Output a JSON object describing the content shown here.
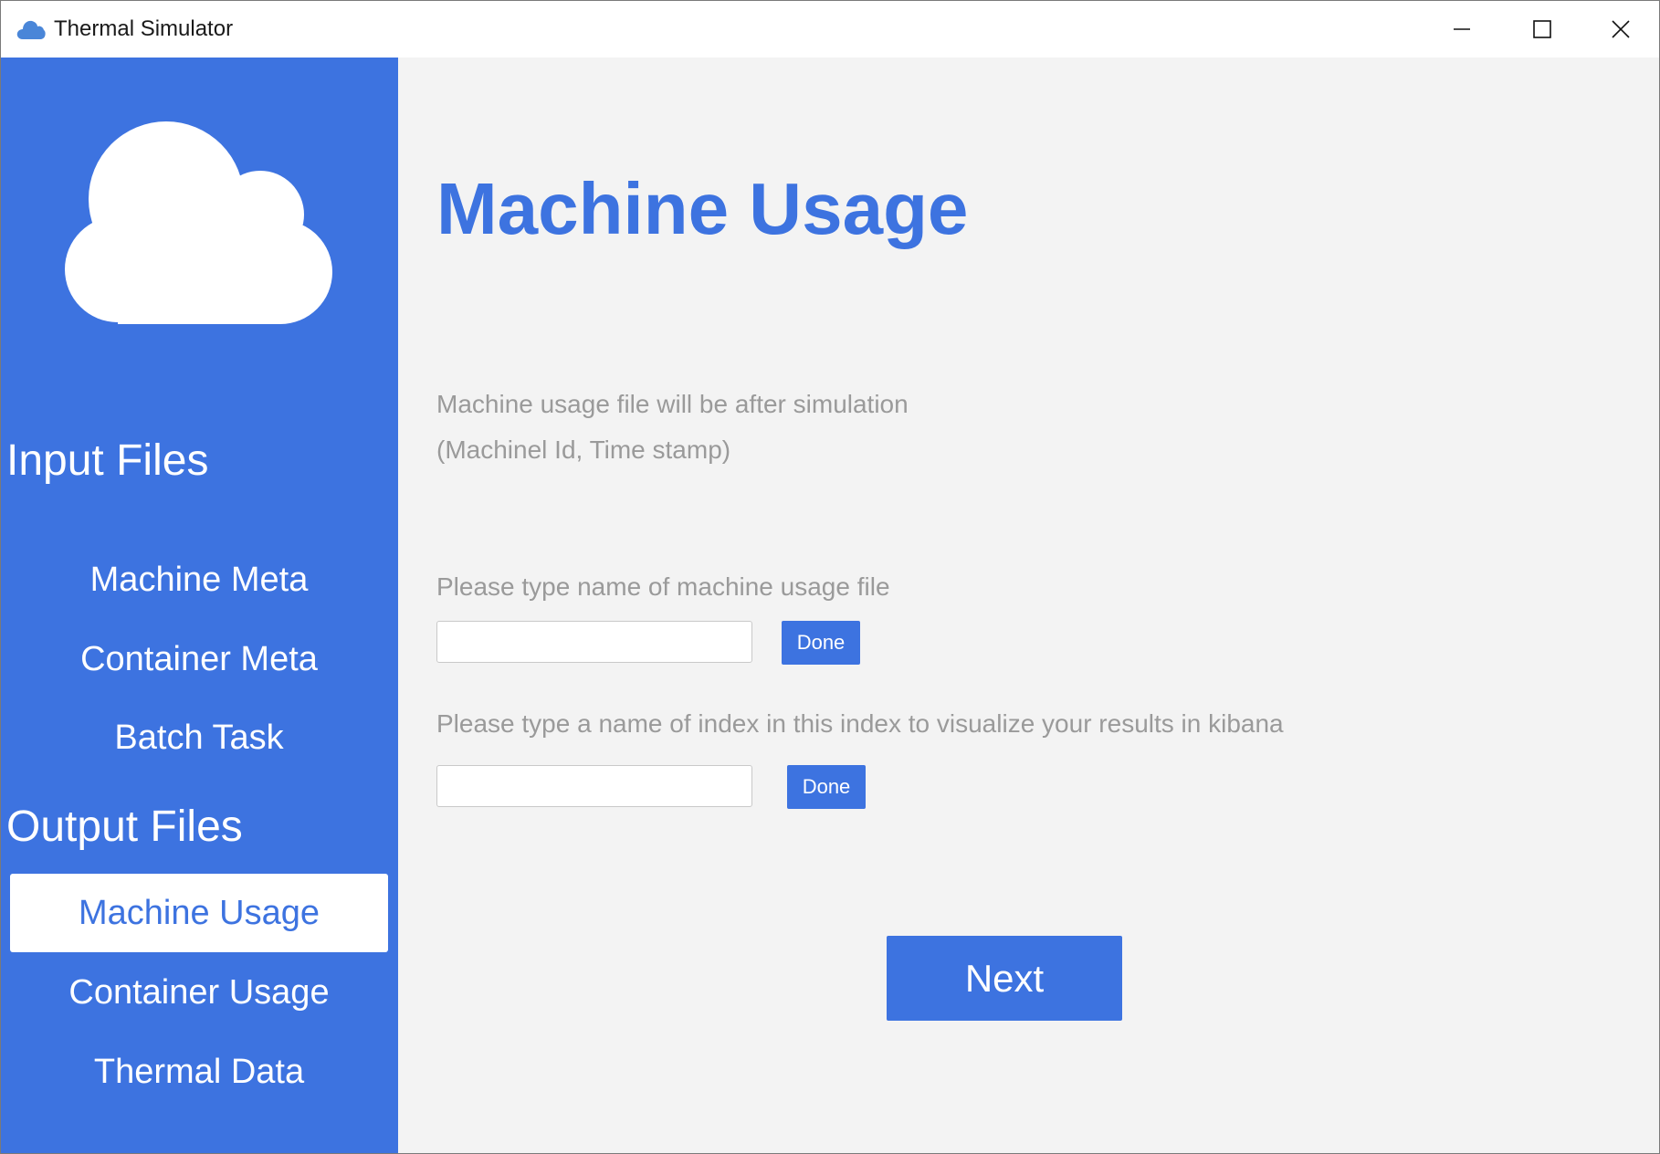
{
  "window": {
    "title": "Thermal Simulator",
    "app_icon": "cloud-icon",
    "controls": [
      "minimize-icon",
      "maximize-icon",
      "close-icon"
    ]
  },
  "sidebar": {
    "logo": "cloud-icon",
    "input_section": {
      "title": "Input Files",
      "items": [
        {
          "label": "Machine Meta"
        },
        {
          "label": "Container Meta"
        },
        {
          "label": "Batch Task"
        }
      ]
    },
    "output_section": {
      "title": "Output Files",
      "items": [
        {
          "label": "Machine Usage",
          "active": true
        },
        {
          "label": "Container Usage"
        },
        {
          "label": "Thermal Data"
        }
      ]
    }
  },
  "main": {
    "title": "Machine Usage",
    "description": [
      "Machine usage file will be after simulation",
      "(Machinel Id, Time stamp)"
    ],
    "file_field": {
      "label": "Please type name of machine usage file",
      "value": "",
      "button": "Done"
    },
    "index_field": {
      "label": "Please type a name of index in this index to visualize your results in kibana",
      "value": "",
      "button": "Done"
    },
    "next_button": "Next"
  },
  "colors": {
    "accent": "#3d73e0",
    "background": "#f3f3f3",
    "muted_text": "#9a9a9a",
    "white": "#ffffff"
  }
}
